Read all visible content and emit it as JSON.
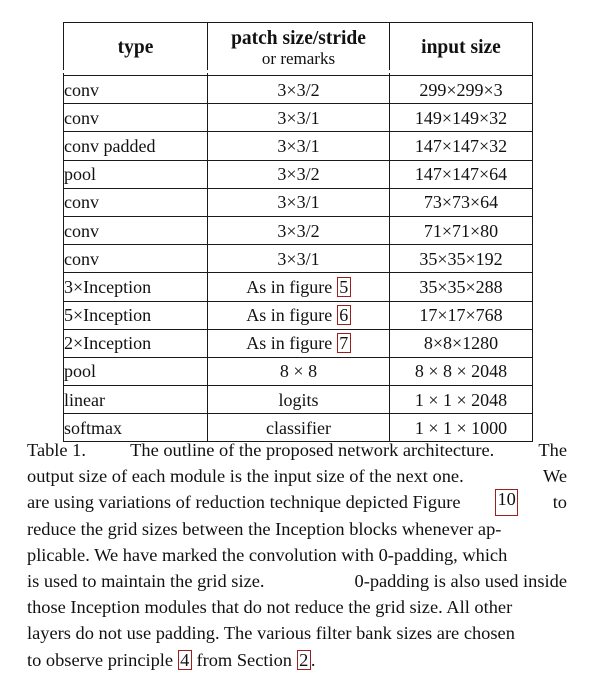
{
  "table": {
    "headers": [
      {
        "main": "type",
        "sub": ""
      },
      {
        "main": "patch size/stride",
        "sub": "or remarks"
      },
      {
        "main": "input size",
        "sub": ""
      }
    ],
    "rows": [
      {
        "type": "conv",
        "patch": "3×3/2",
        "patch_ref": "",
        "input": "299×299×3"
      },
      {
        "type": "conv",
        "patch": "3×3/1",
        "patch_ref": "",
        "input": "149×149×32"
      },
      {
        "type": "conv padded",
        "patch": "3×3/1",
        "patch_ref": "",
        "input": "147×147×32"
      },
      {
        "type": "pool",
        "patch": "3×3/2",
        "patch_ref": "",
        "input": "147×147×64"
      },
      {
        "type": "conv",
        "patch": "3×3/1",
        "patch_ref": "",
        "input": "73×73×64"
      },
      {
        "type": "conv",
        "patch": "3×3/2",
        "patch_ref": "",
        "input": "71×71×80"
      },
      {
        "type": "conv",
        "patch": "3×3/1",
        "patch_ref": "",
        "input": "35×35×192"
      },
      {
        "type": "3×Inception",
        "patch": "As in figure ",
        "patch_ref": "5",
        "input": "35×35×288"
      },
      {
        "type": "5×Inception",
        "patch": "As in figure ",
        "patch_ref": "6",
        "input": "17×17×768"
      },
      {
        "type": "2×Inception",
        "patch": "As in figure ",
        "patch_ref": "7",
        "input": "8×8×1280"
      },
      {
        "type": "pool",
        "patch": "8 × 8",
        "patch_ref": "",
        "input": "8 × 8 × 2048"
      },
      {
        "type": "linear",
        "patch": "logits",
        "patch_ref": "",
        "input": "1 × 1 × 2048"
      },
      {
        "type": "softmax",
        "patch": "classifier",
        "patch_ref": "",
        "input": "1 × 1 × 1000"
      }
    ]
  },
  "caption": {
    "line1_a": "Table 1.",
    "line1_b": "The outline of the proposed network architecture.",
    "line1_c": "The",
    "line2_a": "output size of each module is the input size of the next one.",
    "line2_b": "We",
    "line3_a": "are using variations of reduction technique depicted Figure",
    "line3_ref": "10",
    "line3_b": "to",
    "line4_a": "reduce the grid sizes between the Inception blocks whenever ap-",
    "line5_a": "plicable. We have marked the convolution with 0-padding, which",
    "line6_a": "is used to maintain the grid size.",
    "line6_b": "0-padding is also used inside",
    "line7_a": "those Inception modules that do not reduce the grid size. All other",
    "line8_a": "layers do not use padding. The various filter bank sizes are chosen",
    "line9_a": "to observe principle",
    "line9_ref1": "4",
    "line9_b": "from Section",
    "line9_ref2": "2",
    "line9_c": "."
  },
  "colors": {
    "reference_box_border": "#9c1f1f",
    "table_border": "#1a1a1a",
    "text": "#111111",
    "background": "#ffffff"
  }
}
